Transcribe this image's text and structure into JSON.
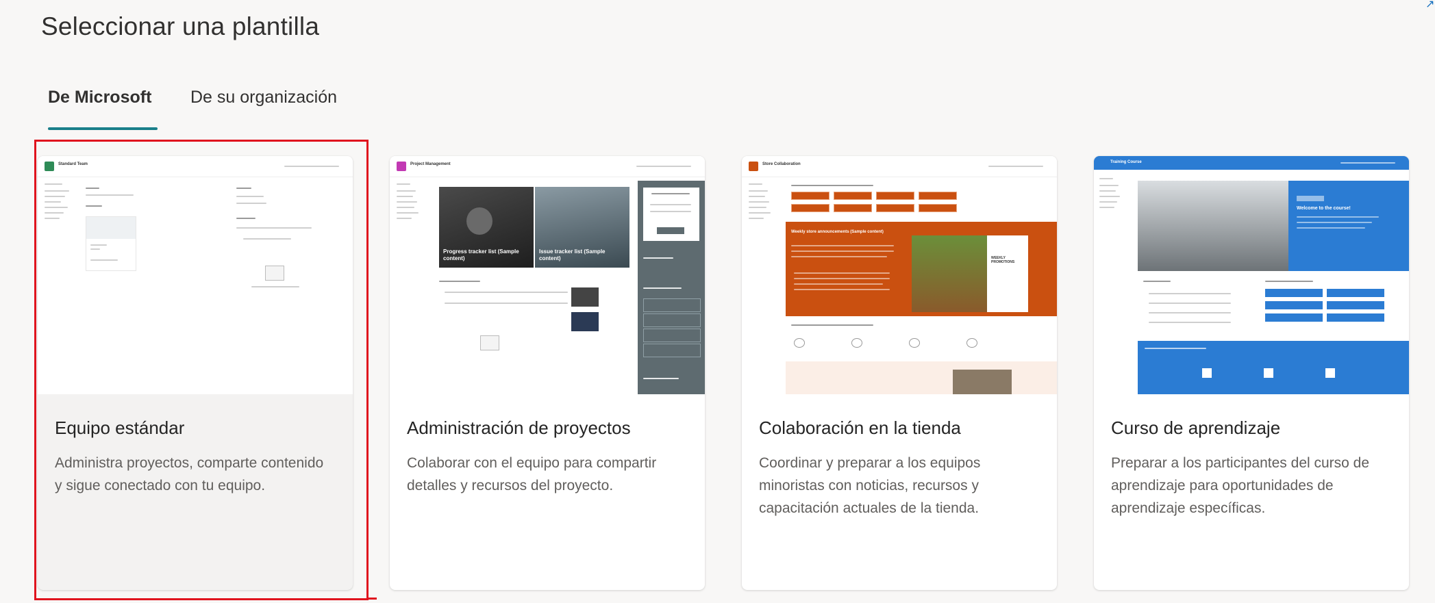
{
  "dialog": {
    "title": "Seleccionar una plantilla"
  },
  "tabs": [
    {
      "label": "De Microsoft",
      "selected": true
    },
    {
      "label": "De su organización",
      "selected": false
    }
  ],
  "accent_color": "#1a7f8a",
  "selection_highlight_color": "#e0141e",
  "templates": [
    {
      "name": "Equipo estándar",
      "description": "Administra proyectos, comparte contenido y sigue conectado con tu equipo.",
      "selected": true,
      "preview": {
        "site_title": "Standard Team",
        "theme_color": "#2e8b57"
      }
    },
    {
      "name": "Administración de proyectos",
      "description": "Colaborar con el equipo para compartir detalles y recursos del proyecto.",
      "selected": false,
      "preview": {
        "site_title": "Project Management",
        "theme_color": "#c239b3",
        "hero_1": "Progress tracker list (Sample content)",
        "hero_2": "Issue tracker list (Sample content)"
      }
    },
    {
      "name": "Colaboración en la tienda",
      "description": "Coordinar y preparar a los equipos minoristas con noticias, recursos y capacitación actuales de la tienda.",
      "selected": false,
      "preview": {
        "site_title": "Store Collaboration",
        "theme_color": "#ca5010",
        "news_heading": "Weekly store announcements (Sample content)",
        "promo": "WEEKLY PROMOTIONS"
      }
    },
    {
      "name": "Curso de aprendizaje",
      "description": "Preparar a los participantes del curso de aprendizaje para oportunidades de aprendizaje específicas.",
      "selected": false,
      "preview": {
        "site_title": "Training Course",
        "theme_color": "#2b7cd3",
        "hero_text": "Welcome to the course!"
      }
    }
  ]
}
